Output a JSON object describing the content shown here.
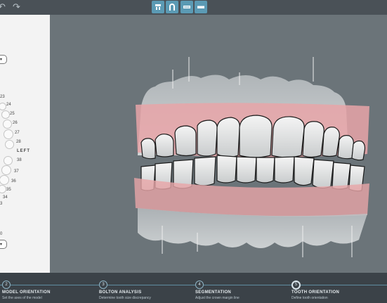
{
  "toolbar": {
    "undo_icon": "undo-icon",
    "redo_icon": "redo-icon",
    "buttons": [
      "front-view-icon",
      "arch-view-icon",
      "upper-jaw-icon",
      "lower-jaw-icon"
    ],
    "accent": "#5b9ab4"
  },
  "sidebar": {
    "upper_numbers": [
      "23",
      "24",
      "25",
      "26",
      "27",
      "28"
    ],
    "side_label": "LEFT",
    "lower_numbers": [
      "38",
      "37",
      "36",
      "35",
      "34",
      "3"
    ],
    "bottom_number": "0"
  },
  "steps": [
    {
      "number": "2",
      "title": "MODEL ORIENTATION",
      "subtitle": "Set the axes of the model"
    },
    {
      "number": "3",
      "title": "BOLTON ANALYSIS",
      "subtitle": "Determine tooth size discrepancy"
    },
    {
      "number": "4",
      "title": "SEGMENTATION",
      "subtitle": "Adjust the crown margin line"
    },
    {
      "number": "5",
      "title": "TOOTH ORIENTATION",
      "subtitle": "Define tooth orientation",
      "active": true
    }
  ],
  "colors": {
    "topbar": "#4a5157",
    "viewport": "#6b7479",
    "footer": "#3b4248",
    "gum": "#e8a5a8"
  }
}
